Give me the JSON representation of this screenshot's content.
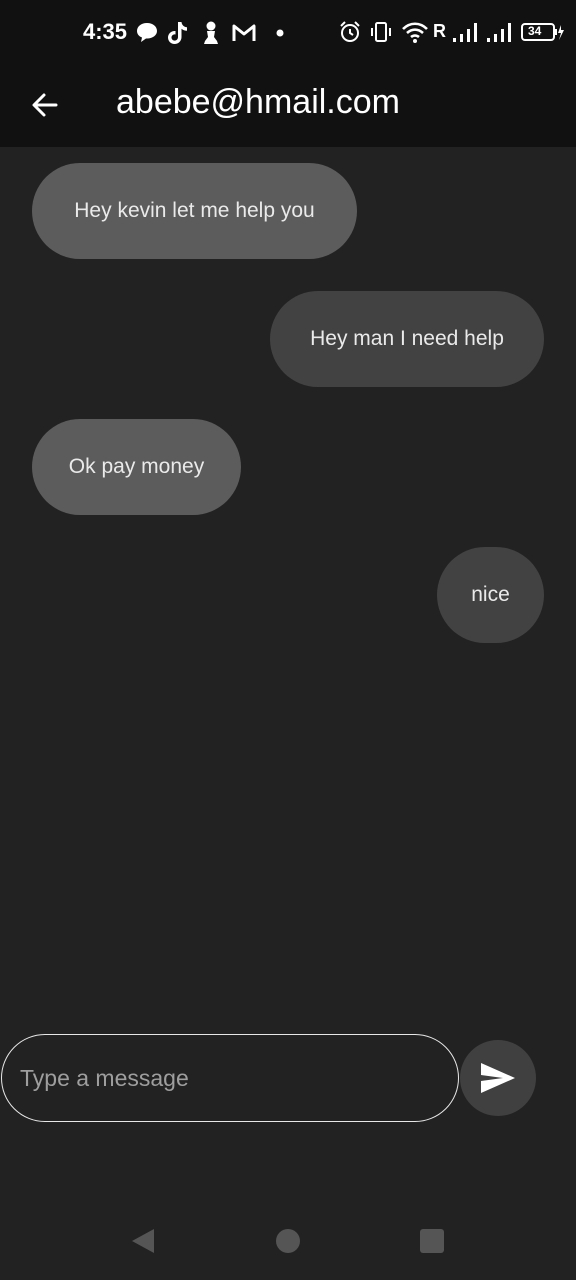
{
  "status_bar": {
    "time": "4:35",
    "battery": "34",
    "carrier_flag": "R",
    "left_icons": [
      "message-bubble-icon",
      "tiktok-icon",
      "chess-pawn-icon",
      "gmail-icon",
      "dot-icon"
    ],
    "right_icons": [
      "alarm-icon",
      "vibrate-icon",
      "wifi-icon",
      "signal-icon",
      "signal-icon",
      "battery-icon"
    ]
  },
  "header": {
    "title": "abebe@hmail.com",
    "back_icon": "arrow-left-icon"
  },
  "messages": [
    {
      "text": "Hey kevin let me help you",
      "direction": "incoming"
    },
    {
      "text": "Hey man I need help",
      "direction": "outgoing"
    },
    {
      "text": "Ok pay money",
      "direction": "incoming"
    },
    {
      "text": "nice",
      "direction": "outgoing"
    }
  ],
  "composer": {
    "placeholder": "Type a message",
    "value": "",
    "send_icon": "send-icon"
  },
  "nav": {
    "buttons": [
      "back-triangle-icon",
      "home-circle-icon",
      "recents-square-icon"
    ]
  },
  "colors": {
    "background": "#222222",
    "bar": "#111111",
    "incoming_bubble": "#5c5c5c",
    "outgoing_bubble": "#424242"
  }
}
